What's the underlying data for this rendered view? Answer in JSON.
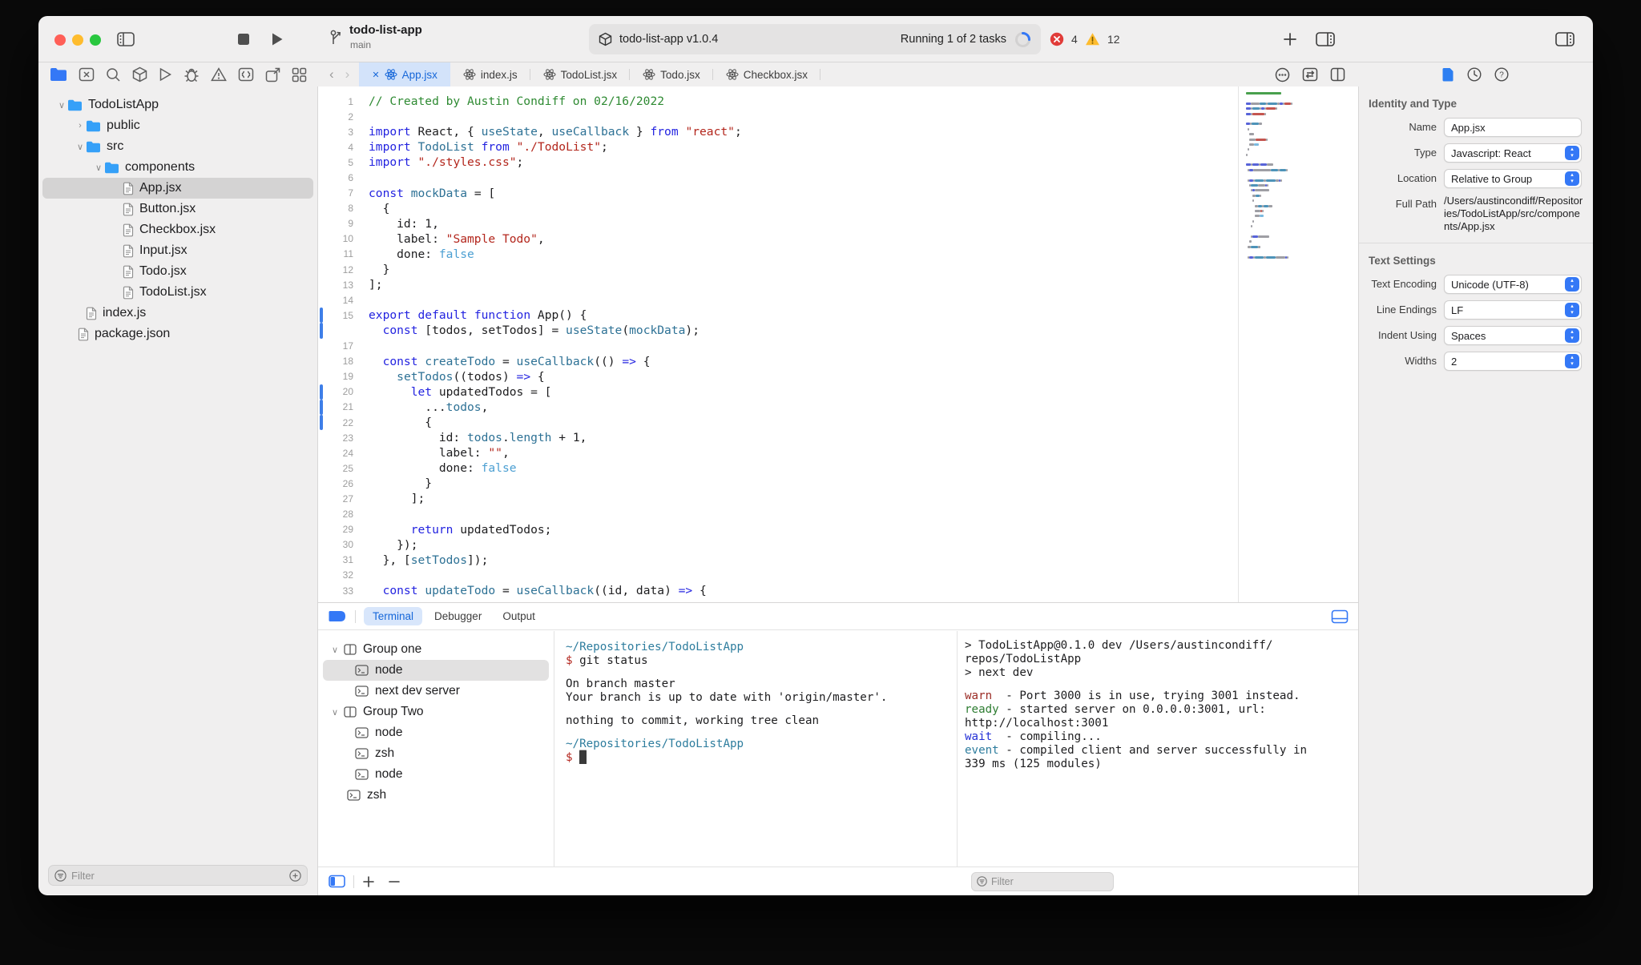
{
  "toolbar": {
    "project": "todo-list-app",
    "branch": "main",
    "status_title": "todo-list-app v1.0.4",
    "tasks": "Running 1 of 2 tasks",
    "error_count": "4",
    "warning_count": "12",
    "accent_color": "#3478f6",
    "error_color": "#e13c39",
    "warning_color": "#febc2e",
    "left_icons": [
      "sidebar-toggle-icon",
      "stop-icon",
      "play-icon"
    ],
    "right_icons": [
      "add-tab-icon",
      "panel-right-icon"
    ]
  },
  "navigator": {
    "toolbar_icons": [
      "project-folder-icon",
      "close-square-icon",
      "search-icon",
      "package-icon",
      "run-icon",
      "bug-icon",
      "issues-icon",
      "extensions-icon",
      "share-icon",
      "grid-icon"
    ],
    "active_icon_index": 0,
    "tree": [
      {
        "label": "TodoListApp",
        "kind": "folder",
        "level": 0,
        "chev": "v"
      },
      {
        "label": "public",
        "kind": "folder",
        "level": 1,
        "chev": ">"
      },
      {
        "label": "src",
        "kind": "folder",
        "level": 1,
        "chev": "v"
      },
      {
        "label": "components",
        "kind": "folder",
        "level": 2,
        "chev": "v"
      },
      {
        "label": "App.jsx",
        "kind": "file",
        "level": 3,
        "selected": true
      },
      {
        "label": "Button.jsx",
        "kind": "file",
        "level": 3
      },
      {
        "label": "Checkbox.jsx",
        "kind": "file",
        "level": 3
      },
      {
        "label": "Input.jsx",
        "kind": "file",
        "level": 3
      },
      {
        "label": "Todo.jsx",
        "kind": "file",
        "level": 3
      },
      {
        "label": "TodoList.jsx",
        "kind": "file",
        "level": 3
      },
      {
        "label": "index.js",
        "kind": "file",
        "level": 1
      },
      {
        "label": "package.json",
        "kind": "file",
        "level": 1,
        "tight": true
      }
    ],
    "filter_placeholder": "Filter"
  },
  "editor": {
    "tabs": [
      {
        "label": "App.jsx",
        "active": true,
        "closable": true
      },
      {
        "label": "index.js"
      },
      {
        "label": "TodoList.jsx"
      },
      {
        "label": "Todo.jsx"
      },
      {
        "label": "Checkbox.jsx"
      }
    ],
    "tab_right_icons": [
      "more-circle-icon",
      "swap-icon",
      "split-editor-icon"
    ],
    "lines": [
      {
        "n": "1",
        "t": [
          [
            "c",
            "// Created by Austin Condiff on 02/16/2022"
          ]
        ]
      },
      {
        "n": "2",
        "t": []
      },
      {
        "n": "3",
        "t": [
          [
            "k",
            "import"
          ],
          [
            "p",
            " React, { "
          ],
          [
            "f",
            "useState"
          ],
          [
            "p",
            ", "
          ],
          [
            "f",
            "useCallback"
          ],
          [
            "p",
            " } "
          ],
          [
            "k",
            "from"
          ],
          [
            "p",
            " "
          ],
          [
            "s",
            "\"react\""
          ],
          [
            "p",
            ";"
          ]
        ]
      },
      {
        "n": "4",
        "t": [
          [
            "k",
            "import"
          ],
          [
            "p",
            " "
          ],
          [
            "f",
            "TodoList"
          ],
          [
            "p",
            " "
          ],
          [
            "k",
            "from"
          ],
          [
            "p",
            " "
          ],
          [
            "s",
            "\"./TodoList\""
          ],
          [
            "p",
            ";"
          ]
        ]
      },
      {
        "n": "5",
        "t": [
          [
            "k",
            "import"
          ],
          [
            "p",
            " "
          ],
          [
            "s",
            "\"./styles.css\""
          ],
          [
            "p",
            ";"
          ]
        ]
      },
      {
        "n": "6",
        "t": []
      },
      {
        "n": "7",
        "t": [
          [
            "k",
            "const"
          ],
          [
            "p",
            " "
          ],
          [
            "f",
            "mockData"
          ],
          [
            "p",
            " = ["
          ]
        ]
      },
      {
        "n": "8",
        "t": [
          [
            "p",
            "  {"
          ]
        ]
      },
      {
        "n": "9",
        "t": [
          [
            "p",
            "    id: 1,"
          ]
        ]
      },
      {
        "n": "10",
        "t": [
          [
            "p",
            "    label: "
          ],
          [
            "s",
            "\"Sample Todo\""
          ],
          [
            "p",
            ","
          ]
        ]
      },
      {
        "n": "11",
        "t": [
          [
            "p",
            "    done: "
          ],
          [
            "b",
            "false"
          ]
        ]
      },
      {
        "n": "12",
        "t": [
          [
            "p",
            "  }"
          ]
        ]
      },
      {
        "n": "13",
        "t": [
          [
            "p",
            "];"
          ]
        ]
      },
      {
        "n": "14",
        "t": []
      },
      {
        "n": "15",
        "changed": true,
        "t": [
          [
            "k",
            "export"
          ],
          [
            "p",
            " "
          ],
          [
            "k",
            "default"
          ],
          [
            "p",
            " "
          ],
          [
            "k",
            "function"
          ],
          [
            "p",
            " App() {"
          ]
        ]
      },
      {
        "n": "",
        "changed": true,
        "t": [
          [
            "p",
            "  "
          ],
          [
            "k",
            "const"
          ],
          [
            "p",
            " [todos, setTodos] = "
          ],
          [
            "f",
            "useState"
          ],
          [
            "p",
            "("
          ],
          [
            "f",
            "mockData"
          ],
          [
            "p",
            ");"
          ]
        ]
      },
      {
        "n": "17",
        "t": []
      },
      {
        "n": "18",
        "t": [
          [
            "p",
            "  "
          ],
          [
            "k",
            "const"
          ],
          [
            "p",
            " "
          ],
          [
            "f",
            "createTodo"
          ],
          [
            "p",
            " = "
          ],
          [
            "f",
            "useCallback"
          ],
          [
            "p",
            "(() "
          ],
          [
            "k",
            "=>"
          ],
          [
            "p",
            " {"
          ]
        ]
      },
      {
        "n": "19",
        "t": [
          [
            "p",
            "    "
          ],
          [
            "f",
            "setTodos"
          ],
          [
            "p",
            "((todos) "
          ],
          [
            "k",
            "=>"
          ],
          [
            "p",
            " {"
          ]
        ]
      },
      {
        "n": "20",
        "changed": true,
        "t": [
          [
            "p",
            "      "
          ],
          [
            "k",
            "let"
          ],
          [
            "p",
            " updatedTodos = ["
          ]
        ]
      },
      {
        "n": "21",
        "changed": true,
        "t": [
          [
            "p",
            "        ..."
          ],
          [
            "f",
            "todos"
          ],
          [
            "p",
            ","
          ]
        ]
      },
      {
        "n": "22",
        "changed": true,
        "t": [
          [
            "p",
            "        {"
          ]
        ]
      },
      {
        "n": "23",
        "t": [
          [
            "p",
            "          id: "
          ],
          [
            "f",
            "todos"
          ],
          [
            "p",
            "."
          ],
          [
            "f",
            "length"
          ],
          [
            "p",
            " + 1,"
          ]
        ]
      },
      {
        "n": "24",
        "t": [
          [
            "p",
            "          label: "
          ],
          [
            "s",
            "\"\""
          ],
          [
            "p",
            ","
          ]
        ]
      },
      {
        "n": "25",
        "t": [
          [
            "p",
            "          done: "
          ],
          [
            "b",
            "false"
          ]
        ]
      },
      {
        "n": "26",
        "t": [
          [
            "p",
            "        }"
          ]
        ]
      },
      {
        "n": "27",
        "t": [
          [
            "p",
            "      ];"
          ]
        ]
      },
      {
        "n": "28",
        "t": []
      },
      {
        "n": "29",
        "t": [
          [
            "p",
            "      "
          ],
          [
            "k",
            "return"
          ],
          [
            "p",
            " updatedTodos;"
          ]
        ]
      },
      {
        "n": "30",
        "t": [
          [
            "p",
            "    });"
          ]
        ]
      },
      {
        "n": "31",
        "t": [
          [
            "p",
            "  }, ["
          ],
          [
            "f",
            "setTodos"
          ],
          [
            "p",
            "]);"
          ]
        ]
      },
      {
        "n": "32",
        "t": []
      },
      {
        "n": "33",
        "t": [
          [
            "p",
            "  "
          ],
          [
            "k",
            "const"
          ],
          [
            "p",
            " "
          ],
          [
            "f",
            "updateTodo"
          ],
          [
            "p",
            " = "
          ],
          [
            "f",
            "useCallback"
          ],
          [
            "p",
            "((id, data) "
          ],
          [
            "k",
            "=>"
          ],
          [
            "p",
            " {"
          ]
        ]
      }
    ]
  },
  "drawer": {
    "tabs": [
      {
        "label": "Terminal",
        "active": true
      },
      {
        "label": "Debugger"
      },
      {
        "label": "Output"
      }
    ],
    "leading_icon": "drawer-pill-icon",
    "trailing_icon": "display-icon",
    "sidebar": [
      {
        "label": "Group one",
        "type": "group",
        "level": 0
      },
      {
        "label": "node",
        "type": "terminal",
        "level": 1,
        "selected": true
      },
      {
        "label": "next dev server",
        "type": "terminal",
        "level": 1
      },
      {
        "label": "Group Two",
        "type": "group",
        "level": 0
      },
      {
        "label": "node",
        "type": "terminal",
        "level": 1
      },
      {
        "label": "zsh",
        "type": "terminal",
        "level": 1
      },
      {
        "label": "node",
        "type": "terminal",
        "level": 1
      },
      {
        "label": "zsh",
        "type": "terminal",
        "level": 0
      }
    ],
    "left_output": [
      [
        [
          "path",
          "~/Repositories/TodoListApp"
        ]
      ],
      [
        [
          "prompt",
          "$"
        ],
        [
          "plain",
          " git status"
        ]
      ],
      [],
      [
        [
          "plain",
          "On branch master"
        ]
      ],
      [
        [
          "plain",
          "Your branch is up to date with 'origin/master'."
        ]
      ],
      [],
      [
        [
          "plain",
          "nothing to commit, working tree clean"
        ]
      ],
      [],
      [
        [
          "path",
          "~/Repositories/TodoListApp"
        ]
      ],
      [
        [
          "prompt",
          "$"
        ],
        [
          "plain",
          " "
        ],
        [
          "cursor",
          "█"
        ]
      ]
    ],
    "right_output": [
      [
        [
          "plain",
          "> TodoListApp@0.1.0 dev /Users/austincondiff/"
        ]
      ],
      [
        [
          "plain",
          "repos/TodoListApp"
        ]
      ],
      [
        [
          "plain",
          "> next dev"
        ]
      ],
      [],
      [
        [
          "warn",
          "warn"
        ],
        [
          "plain",
          "  - Port 3000 is in use, trying 3001 instead."
        ]
      ],
      [
        [
          "ready",
          "ready"
        ],
        [
          "plain",
          " - started server on 0.0.0.0:3001, url:"
        ]
      ],
      [
        [
          "plain",
          "http://localhost:3001"
        ]
      ],
      [
        [
          "wait",
          "wait"
        ],
        [
          "plain",
          "  - compiling..."
        ]
      ],
      [
        [
          "event",
          "event"
        ],
        [
          "plain",
          " - compiled client and server successfully in"
        ]
      ],
      [
        [
          "plain",
          "339 ms (125 modules)"
        ]
      ]
    ],
    "bottom_icons": [
      "panel-left-icon",
      "add-icon",
      "minus-icon"
    ],
    "filter_placeholder": "Filter"
  },
  "inspector": {
    "header_icons": [
      "file-inspector-icon",
      "history-inspector-icon",
      "help-inspector-icon"
    ],
    "sections": [
      {
        "title": "Identity and Type",
        "rows": [
          {
            "label": "Name",
            "control": "input",
            "value": "App.jsx"
          },
          {
            "label": "Type",
            "control": "select",
            "value": "Javascript: React"
          },
          {
            "label": "Location",
            "control": "select",
            "value": "Relative to Group"
          },
          {
            "label": "Full Path",
            "control": "text",
            "value": "/Users/austincondiff/Repositories/TodoListApp/src/components/App.jsx"
          }
        ]
      },
      {
        "title": "Text Settings",
        "rows": [
          {
            "label": "Text Encoding",
            "control": "select",
            "value": "Unicode (UTF-8)"
          },
          {
            "label": "Line Endings",
            "control": "select",
            "value": "LF"
          },
          {
            "label": "Indent Using",
            "control": "select",
            "value": "Spaces"
          },
          {
            "label": "Widths",
            "control": "select",
            "value": "2"
          }
        ]
      }
    ]
  }
}
